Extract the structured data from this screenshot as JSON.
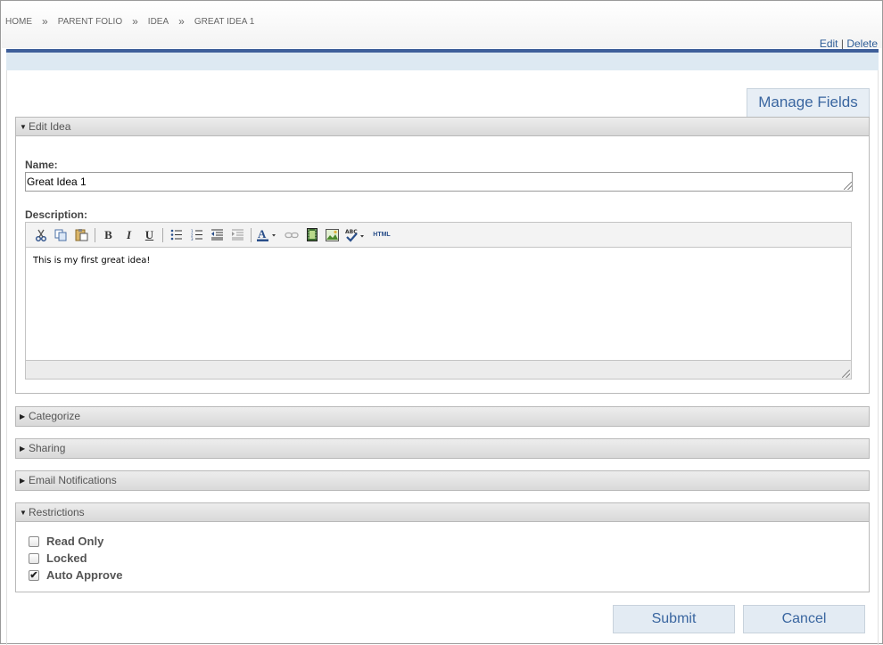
{
  "breadcrumb": [
    {
      "label": "HOME"
    },
    {
      "label": "PARENT FOLIO"
    },
    {
      "label": "IDEA"
    },
    {
      "label": "GREAT IDEA 1"
    }
  ],
  "breadcrumb_separator": "»",
  "top_actions": {
    "edit": "Edit",
    "divider": "|",
    "delete": "Delete"
  },
  "manage_fields": "Manage Fields",
  "edit_section": {
    "title": "Edit Idea",
    "name_label": "Name:",
    "name_value": "Great Idea 1",
    "description_label": "Description:",
    "description_value": "This is my first great idea!"
  },
  "toolbar": {
    "bold": "B",
    "italic": "I",
    "underline": "U",
    "html": "HTML",
    "font_color": "A"
  },
  "collapsed_sections": [
    {
      "title": "Categorize"
    },
    {
      "title": "Sharing"
    },
    {
      "title": "Email Notifications"
    }
  ],
  "restrictions": {
    "title": "Restrictions",
    "options": [
      {
        "label": "Read Only",
        "checked": false
      },
      {
        "label": "Locked",
        "checked": false
      },
      {
        "label": "Auto Approve",
        "checked": true
      }
    ]
  },
  "buttons": {
    "submit": "Submit",
    "cancel": "Cancel"
  },
  "colors": {
    "accent_blue": "#3e5f9a",
    "link_blue": "#3a66a0",
    "band": "#dde9f2"
  }
}
